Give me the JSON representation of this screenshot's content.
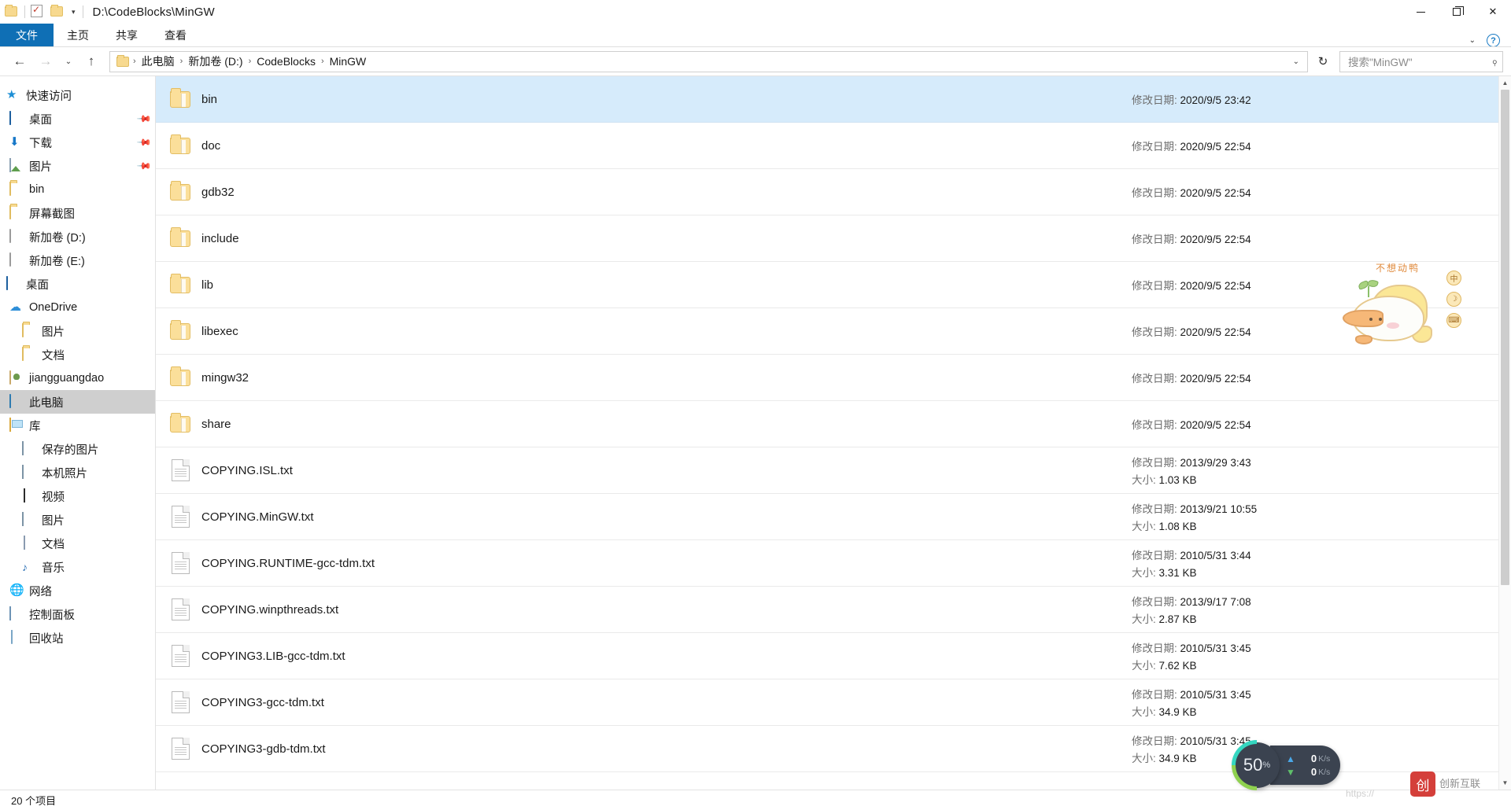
{
  "window": {
    "title_path": "D:\\CodeBlocks\\MinGW",
    "quick_access_icons": [
      "folder-icon",
      "properties-icon",
      "new-folder-icon",
      "customize-caret-icon"
    ],
    "controls": {
      "minimize": "minimize-icon",
      "maximize": "maximize-icon",
      "close": "close-icon"
    }
  },
  "ribbon": {
    "tabs": [
      {
        "label": "文件",
        "active_file": true
      },
      {
        "label": "主页",
        "active_file": false
      },
      {
        "label": "共享",
        "active_file": false
      },
      {
        "label": "查看",
        "active_file": false
      }
    ],
    "collapse_caret": "⌄",
    "help": "?"
  },
  "address": {
    "back": "←",
    "forward": "→",
    "recent_caret": "⌄",
    "up": "↑",
    "crumbs": [
      "此电脑",
      "新加卷 (D:)",
      "CodeBlocks",
      "MinGW"
    ],
    "dropdown_caret": "⌄",
    "refresh": "↻",
    "search_placeholder": "搜索\"MinGW\"",
    "search_icon": "search-icon"
  },
  "sidebar": {
    "groups": [
      {
        "name": "快速访问",
        "icon": "star-icon",
        "indent": 0,
        "items": [
          {
            "label": "桌面",
            "icon": "desktop-icon",
            "pinned": true,
            "indent": 1
          },
          {
            "label": "下载",
            "icon": "download-icon",
            "pinned": true,
            "indent": 1
          },
          {
            "label": "图片",
            "icon": "pictures-icon",
            "pinned": true,
            "indent": 1
          },
          {
            "label": "bin",
            "icon": "folder-icon",
            "pinned": false,
            "indent": 1
          },
          {
            "label": "屏幕截图",
            "icon": "folder-icon",
            "pinned": false,
            "indent": 1
          },
          {
            "label": "新加卷 (D:)",
            "icon": "drive-icon",
            "pinned": false,
            "indent": 1
          },
          {
            "label": "新加卷 (E:)",
            "icon": "drive-icon",
            "pinned": false,
            "indent": 1
          }
        ]
      },
      {
        "name": "桌面",
        "icon": "desktop-icon",
        "indent": 0,
        "items": [
          {
            "label": "OneDrive",
            "icon": "cloud-icon",
            "pinned": false,
            "indent": 1
          },
          {
            "label": "图片",
            "icon": "folder-icon",
            "pinned": false,
            "indent": 2
          },
          {
            "label": "文档",
            "icon": "folder-icon",
            "pinned": false,
            "indent": 2
          },
          {
            "label": "jiangguangdao",
            "icon": "user-icon",
            "pinned": false,
            "indent": 1
          },
          {
            "label": "此电脑",
            "icon": "pc-icon",
            "pinned": false,
            "indent": 1,
            "selected": true
          },
          {
            "label": "库",
            "icon": "library-icon",
            "pinned": false,
            "indent": 1
          },
          {
            "label": "保存的图片",
            "icon": "monitor-icon",
            "pinned": false,
            "indent": 2
          },
          {
            "label": "本机照片",
            "icon": "monitor-icon",
            "pinned": false,
            "indent": 2
          },
          {
            "label": "视频",
            "icon": "video-icon",
            "pinned": false,
            "indent": 2
          },
          {
            "label": "图片",
            "icon": "monitor-icon",
            "pinned": false,
            "indent": 2
          },
          {
            "label": "文档",
            "icon": "document-icon",
            "pinned": false,
            "indent": 2
          },
          {
            "label": "音乐",
            "icon": "music-icon",
            "pinned": false,
            "indent": 2
          },
          {
            "label": "网络",
            "icon": "network-icon",
            "pinned": false,
            "indent": 1
          },
          {
            "label": "控制面板",
            "icon": "control-panel-icon",
            "pinned": false,
            "indent": 1
          },
          {
            "label": "回收站",
            "icon": "recycle-bin-icon",
            "pinned": false,
            "indent": 1
          }
        ]
      }
    ]
  },
  "filelist": {
    "date_label": "修改日期:",
    "size_label": "大小:",
    "rows": [
      {
        "name": "bin",
        "type": "folder",
        "date": "2020/9/5 23:42",
        "size": null,
        "selected": true
      },
      {
        "name": "doc",
        "type": "folder",
        "date": "2020/9/5 22:54",
        "size": null,
        "selected": false
      },
      {
        "name": "gdb32",
        "type": "folder",
        "date": "2020/9/5 22:54",
        "size": null,
        "selected": false
      },
      {
        "name": "include",
        "type": "folder",
        "date": "2020/9/5 22:54",
        "size": null,
        "selected": false
      },
      {
        "name": "lib",
        "type": "folder",
        "date": "2020/9/5 22:54",
        "size": null,
        "selected": false
      },
      {
        "name": "libexec",
        "type": "folder",
        "date": "2020/9/5 22:54",
        "size": null,
        "selected": false
      },
      {
        "name": "mingw32",
        "type": "folder",
        "date": "2020/9/5 22:54",
        "size": null,
        "selected": false
      },
      {
        "name": "share",
        "type": "folder",
        "date": "2020/9/5 22:54",
        "size": null,
        "selected": false
      },
      {
        "name": "COPYING.ISL.txt",
        "type": "text",
        "date": "2013/9/29 3:43",
        "size": "1.03 KB",
        "selected": false
      },
      {
        "name": "COPYING.MinGW.txt",
        "type": "text",
        "date": "2013/9/21 10:55",
        "size": "1.08 KB",
        "selected": false
      },
      {
        "name": "COPYING.RUNTIME-gcc-tdm.txt",
        "type": "text",
        "date": "2010/5/31 3:44",
        "size": "3.31 KB",
        "selected": false
      },
      {
        "name": "COPYING.winpthreads.txt",
        "type": "text",
        "date": "2013/9/17 7:08",
        "size": "2.87 KB",
        "selected": false
      },
      {
        "name": "COPYING3.LIB-gcc-tdm.txt",
        "type": "text",
        "date": "2010/5/31 3:45",
        "size": "7.62 KB",
        "selected": false
      },
      {
        "name": "COPYING3-gcc-tdm.txt",
        "type": "text",
        "date": "2010/5/31 3:45",
        "size": "34.9 KB",
        "selected": false
      },
      {
        "name": "COPYING3-gdb-tdm.txt",
        "type": "text",
        "date": "2010/5/31 3:45",
        "size": "34.9 KB",
        "selected": false
      }
    ]
  },
  "statusbar": {
    "item_count": "20 个项目"
  },
  "net_widget": {
    "percent": "50",
    "percent_symbol": "%",
    "upload_value": "0",
    "upload_unit": "K/s",
    "download_value": "0",
    "download_unit": "K/s",
    "upload_icon": "arrow-up-icon",
    "download_icon": "arrow-down-icon",
    "ring_color": "#8fd14f"
  },
  "mascot": {
    "caption": "不想动鸭",
    "buttons": [
      "中",
      "☽",
      "⌨"
    ]
  },
  "watermark": {
    "url": "https://",
    "brand": "创新互联"
  }
}
